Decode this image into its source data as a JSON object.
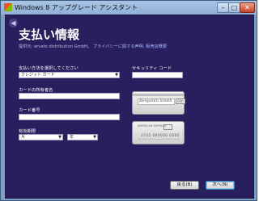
{
  "window": {
    "title": "Windows 8 アップグレード アシスタント",
    "minimize": "–",
    "maximize": "□",
    "close": "✕"
  },
  "page": {
    "heading": "支払い情報",
    "provider_text": "提供元: arvato distribution GmbH。",
    "provider_links": "プライバシーに関する声明, 販売店概要"
  },
  "form": {
    "payment_method_label": "支払い方法を選択してください",
    "payment_method_value": "クレジット カード",
    "cardholder_label": "カードの所有者名",
    "card_number_label": "カード番号",
    "expiry_label": "有効期限",
    "expiry_month_value": "月",
    "expiry_year_value": "年",
    "security_code_label": "セキュリティ コード"
  },
  "cards": {
    "back_signature": "Benjamin Smith",
    "back_cvv": "000",
    "front_header": "AMERICAN EXPRESS",
    "front_number": "3745 000000 0000"
  },
  "buttons": {
    "back": "戻る(B)",
    "next": "次へ(N)"
  }
}
